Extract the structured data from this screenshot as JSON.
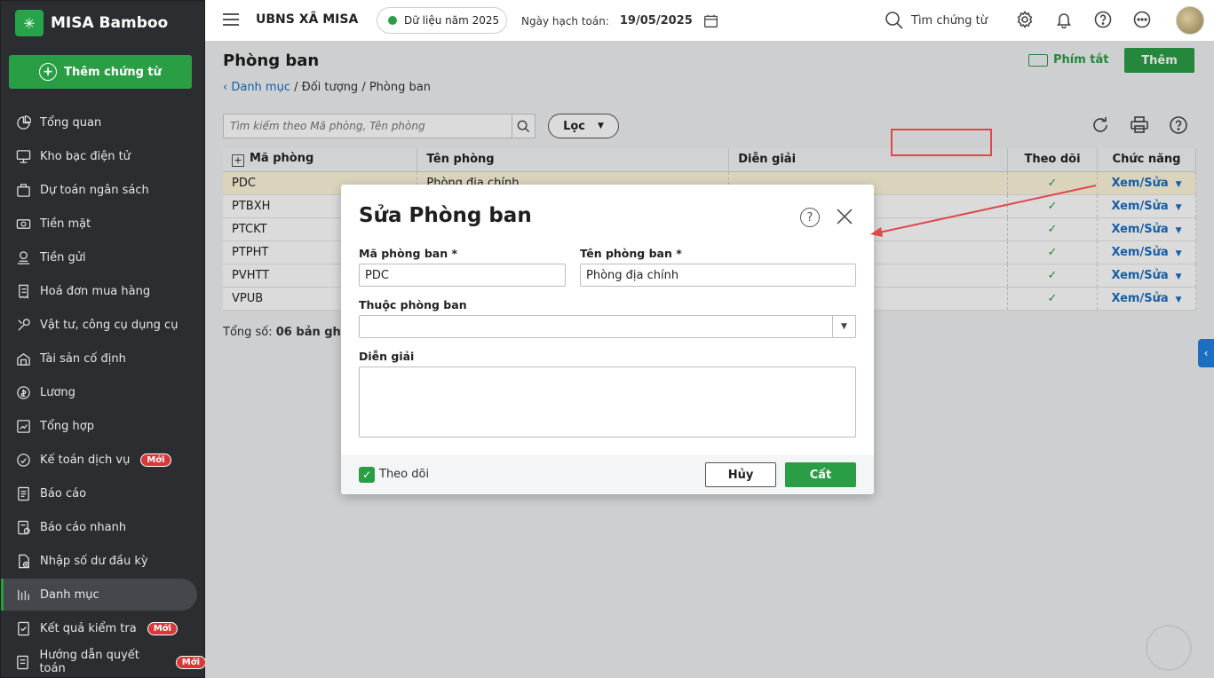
{
  "app": {
    "brand": "MISA Bamboo",
    "new_doc": "Thêm chứng từ"
  },
  "sidebar": {
    "items": [
      {
        "label": "Tổng quan",
        "icon": "pie-chart-icon"
      },
      {
        "label": "Kho bạc điện tử",
        "icon": "monitor-icon"
      },
      {
        "label": "Dự toán ngân sách",
        "icon": "budget-icon"
      },
      {
        "label": "Tiền mặt",
        "icon": "cash-icon"
      },
      {
        "label": "Tiền gửi",
        "icon": "deposit-icon"
      },
      {
        "label": "Hoá đơn mua hàng",
        "icon": "invoice-icon"
      },
      {
        "label": "Vật tư, công cụ dụng cụ",
        "icon": "tools-icon"
      },
      {
        "label": "Tài sản cố định",
        "icon": "asset-icon"
      },
      {
        "label": "Lương",
        "icon": "salary-icon"
      },
      {
        "label": "Tổng hợp",
        "icon": "summary-icon"
      },
      {
        "label": "Kế toán dịch vụ",
        "icon": "service-icon",
        "badge": "Mới"
      },
      {
        "label": "Báo cáo",
        "icon": "report-icon"
      },
      {
        "label": "Báo cáo nhanh",
        "icon": "quick-report-icon"
      },
      {
        "label": "Nhập số dư đầu kỳ",
        "icon": "opening-balance-icon"
      },
      {
        "label": "Danh mục",
        "icon": "catalog-icon",
        "active": true
      },
      {
        "label": "Kết quả kiểm tra",
        "icon": "check-result-icon",
        "badge": "Mới"
      },
      {
        "label": "Hướng dẫn quyết toán",
        "icon": "guide-icon",
        "badge": "Mới"
      }
    ]
  },
  "topbar": {
    "org": "UBNS XÃ MISA",
    "year": "Dữ liệu năm 2025",
    "acc_date_label": "Ngày hạch toán:",
    "acc_date": "19/05/2025",
    "search": "Tìm chứng từ"
  },
  "page": {
    "title": "Phòng ban",
    "shortcut": "Phím tắt",
    "add": "Thêm",
    "breadcrumb_link": "Danh mục",
    "breadcrumb_rest": " / Đối tượng / Phòng ban",
    "search_placeholder": "Tìm kiếm theo Mã phòng, Tên phòng",
    "filter": "Lọc",
    "total_label": "Tổng số:",
    "total_value": "06 bản ghi"
  },
  "table": {
    "headers": {
      "code": "Mã phòng",
      "name": "Tên phòng",
      "desc": "Diễn giải",
      "track": "Theo dõi",
      "action": "Chức năng"
    },
    "rows": [
      {
        "code": "PDC",
        "name": "Phòng địa chính",
        "action": "Xem/Sửa"
      },
      {
        "code": "PTBXH",
        "name": "",
        "action": "Xem/Sửa"
      },
      {
        "code": "PTCKT",
        "name": "",
        "action": "Xem/Sửa"
      },
      {
        "code": "PTPHT",
        "name": "",
        "action": "Xem/Sửa"
      },
      {
        "code": "PVHTT",
        "name": "",
        "action": "Xem/Sửa"
      },
      {
        "code": "VPUB",
        "name": "",
        "action": "Xem/Sửa"
      }
    ]
  },
  "dialog": {
    "title": "Sửa Phòng ban",
    "code_label": "Mã phòng ban *",
    "code_value": "PDC",
    "name_label": "Tên phòng ban *",
    "name_value": "Phòng địa chính",
    "parent_label": "Thuộc phòng ban",
    "desc_label": "Diễn giải",
    "track_label": "Theo dõi",
    "cancel": "Hủy",
    "save": "Cất"
  },
  "colors": {
    "brand_green": "#2a9e45",
    "link_blue": "#1b6ec2",
    "highlight_red": "#e04848",
    "sidebar_bg": "#2b2d31"
  }
}
